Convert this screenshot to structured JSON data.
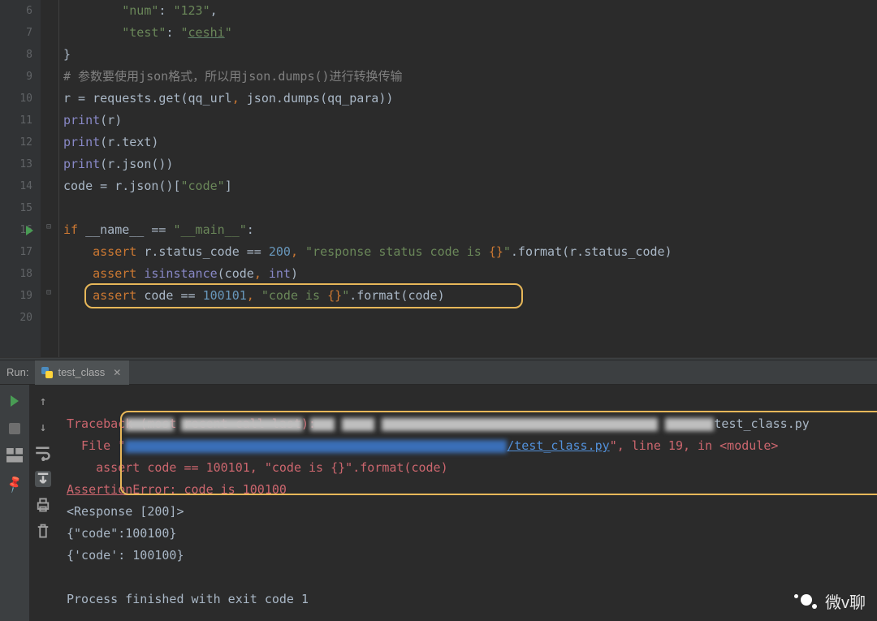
{
  "editor": {
    "lines": [
      6,
      7,
      8,
      9,
      10,
      11,
      12,
      13,
      14,
      15,
      16,
      17,
      18,
      19,
      20
    ],
    "code": {
      "6": {
        "seg": [
          [
            "        ",
            ""
          ],
          [
            "\"num\"",
            "c-str"
          ],
          [
            ": ",
            ""
          ],
          [
            "\"123\"",
            "c-str"
          ],
          [
            ",",
            ""
          ]
        ]
      },
      "7": {
        "seg": [
          [
            "        ",
            ""
          ],
          [
            "\"test\"",
            "c-str"
          ],
          [
            ": ",
            ""
          ],
          [
            "\"",
            "c-str"
          ],
          [
            "ceshi",
            "c-str c-und"
          ],
          [
            "\"",
            "c-str"
          ]
        ]
      },
      "8": {
        "seg": [
          [
            "}",
            ""
          ]
        ]
      },
      "9": {
        "seg": [
          [
            "# 参数要使用json格式，所以用json.dumps()进行转换传输",
            "c-gray"
          ]
        ]
      },
      "10": {
        "seg": [
          [
            "r = requests.get(qq_url",
            ""
          ],
          [
            ", ",
            "c-orange"
          ],
          [
            "json.dumps(qq_para))",
            ""
          ]
        ]
      },
      "11": {
        "seg": [
          [
            "print",
            "c-builtin"
          ],
          [
            "(r)",
            ""
          ]
        ]
      },
      "12": {
        "seg": [
          [
            "print",
            "c-builtin"
          ],
          [
            "(r.text)",
            ""
          ]
        ]
      },
      "13": {
        "seg": [
          [
            "print",
            "c-builtin"
          ],
          [
            "(r.json())",
            ""
          ]
        ]
      },
      "14": {
        "seg": [
          [
            "code = r.json()[",
            ""
          ],
          [
            "\"code\"",
            "c-str"
          ],
          [
            "]",
            ""
          ]
        ]
      },
      "15": {
        "seg": [
          [
            "",
            ""
          ]
        ]
      },
      "16": {
        "seg": [
          [
            "if ",
            "c-orange"
          ],
          [
            "__name__ == ",
            ""
          ],
          [
            "\"__main__\"",
            "c-str"
          ],
          [
            ":",
            ""
          ]
        ]
      },
      "17": {
        "seg": [
          [
            "    ",
            ""
          ],
          [
            "assert ",
            "c-orange"
          ],
          [
            "r.status_code == ",
            ""
          ],
          [
            "200",
            "c-blue"
          ],
          [
            ", ",
            "c-orange"
          ],
          [
            "\"response status code is ",
            "c-str"
          ],
          [
            "{}",
            "c-orange"
          ],
          [
            "\"",
            "c-str"
          ],
          [
            ".format(r.status_code)",
            ""
          ]
        ]
      },
      "18": {
        "seg": [
          [
            "    ",
            ""
          ],
          [
            "assert ",
            "c-orange"
          ],
          [
            "isinstance",
            "c-builtin"
          ],
          [
            "(code",
            ""
          ],
          [
            ", ",
            "c-orange"
          ],
          [
            "int",
            "c-builtin"
          ],
          [
            ")",
            ""
          ]
        ]
      },
      "19": {
        "seg": [
          [
            "    ",
            ""
          ],
          [
            "assert ",
            "c-orange"
          ],
          [
            "code == ",
            ""
          ],
          [
            "100101",
            "c-blue"
          ],
          [
            ", ",
            "c-orange"
          ],
          [
            "\"code is ",
            "c-str"
          ],
          [
            "{}",
            "c-orange"
          ],
          [
            "\"",
            "c-str"
          ],
          [
            ".format(code)",
            ""
          ]
        ]
      },
      "20": {
        "seg": [
          [
            "",
            ""
          ]
        ]
      }
    }
  },
  "run": {
    "tab_label": "Run:",
    "config_name": "test_class",
    "cmd_suffix": "test_class.py",
    "traceback_head": "Traceback (most recent call last):",
    "file_link": "/test_class.py",
    "file_line_suffix": "\", line 19, in <module>",
    "file_prefix": "  File \"",
    "assert_line": "    assert code == 100101, \"code is {}\".format(code)",
    "assertion_error": "AssertionError: code is 100100",
    "resp_line": "<Response [200]>",
    "json1": "{\"code\":100100}",
    "json2": "{'code': 100100}",
    "exit_line": "Process finished with exit code 1"
  },
  "watermark": {
    "text": "微v聊"
  }
}
